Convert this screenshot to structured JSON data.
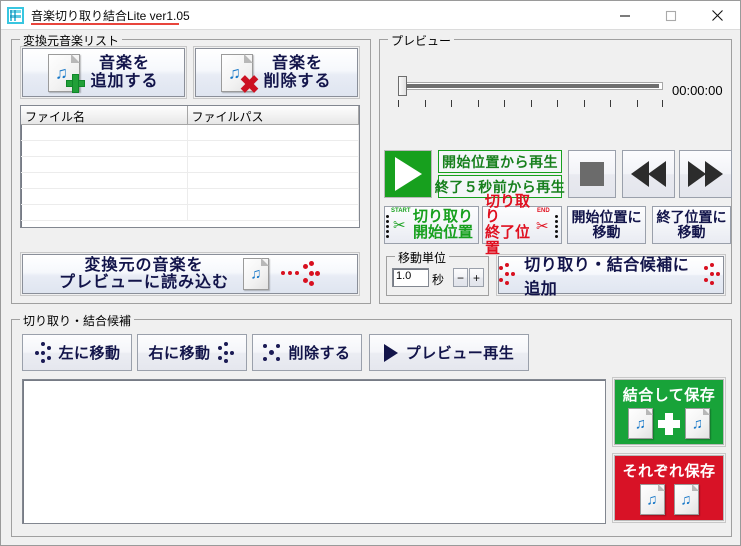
{
  "window": {
    "title": "音楽切り取り結合Lite ver1.05",
    "app_icon": "app-icon",
    "minimize_label": "−",
    "maximize_label": "□",
    "close_label": "✕",
    "accent_red": "#e8453c",
    "accent_green": "#17a01e"
  },
  "source_list_group": {
    "legend": "変換元音楽リスト",
    "add_button": {
      "line1": "音楽を",
      "line2": "追加する",
      "icon": "music-file-add-icon"
    },
    "remove_button": {
      "line1": "音楽を",
      "line2": "削除する",
      "icon": "music-file-remove-icon"
    },
    "columns": [
      "ファイル名",
      "ファイルパス"
    ],
    "rows": [],
    "load_button": {
      "line1": "変換元の音楽を",
      "line2": "プレビューに読み込む",
      "icon": "music-file-icon",
      "arrow_icon": "dotted-arrow-icon"
    }
  },
  "preview_group": {
    "legend": "プレビュー",
    "timecode": "00:00:00",
    "slider": {
      "value": 0,
      "min": 0,
      "max": 100,
      "ticks": 11
    },
    "play_button": {
      "icon": "play-icon"
    },
    "play_from_start": "開始位置から再生",
    "play_last5": "終了５秒前から再生",
    "stop_button": {
      "icon": "stop-icon"
    },
    "rewind_button": {
      "icon": "rewind-icon"
    },
    "forward_button": {
      "icon": "fast-forward-icon"
    },
    "cut_start_button": {
      "line1": "切り取り",
      "line2": "開始位置",
      "tag": "START",
      "icon": "scissors-icon"
    },
    "cut_end_button": {
      "line1": "切り取り",
      "line2": "終了位置",
      "tag": "END",
      "icon": "scissors-icon"
    },
    "goto_start_button": {
      "line1": "開始位置に",
      "line2": "移動"
    },
    "goto_end_button": {
      "line1": "終了位置に",
      "line2": "移動"
    },
    "unit_group": {
      "legend": "移動単位",
      "value": "1.0",
      "suffix": "秒",
      "minus": "−",
      "plus": "+"
    },
    "add_candidate_button": {
      "label": "切り取り・結合候補に追加",
      "icon": "dotted-arrow-icon"
    }
  },
  "candidates_group": {
    "legend": "切り取り・結合候補",
    "move_left_button": {
      "label": "左に移動",
      "icon": "dots-left-icon"
    },
    "move_right_button": {
      "label": "右に移動",
      "icon": "dots-right-icon"
    },
    "delete_button": {
      "label": "削除する",
      "icon": "dots-x-icon"
    },
    "preview_play_button": {
      "label": "プレビュー再生",
      "icon": "play-icon"
    },
    "rows": [],
    "merge_save_button": {
      "label": "結合して保存",
      "icon": "music-file-icon",
      "operator": "+"
    },
    "separate_save_button": {
      "label": "それぞれ保存",
      "icon": "music-file-icon"
    }
  }
}
